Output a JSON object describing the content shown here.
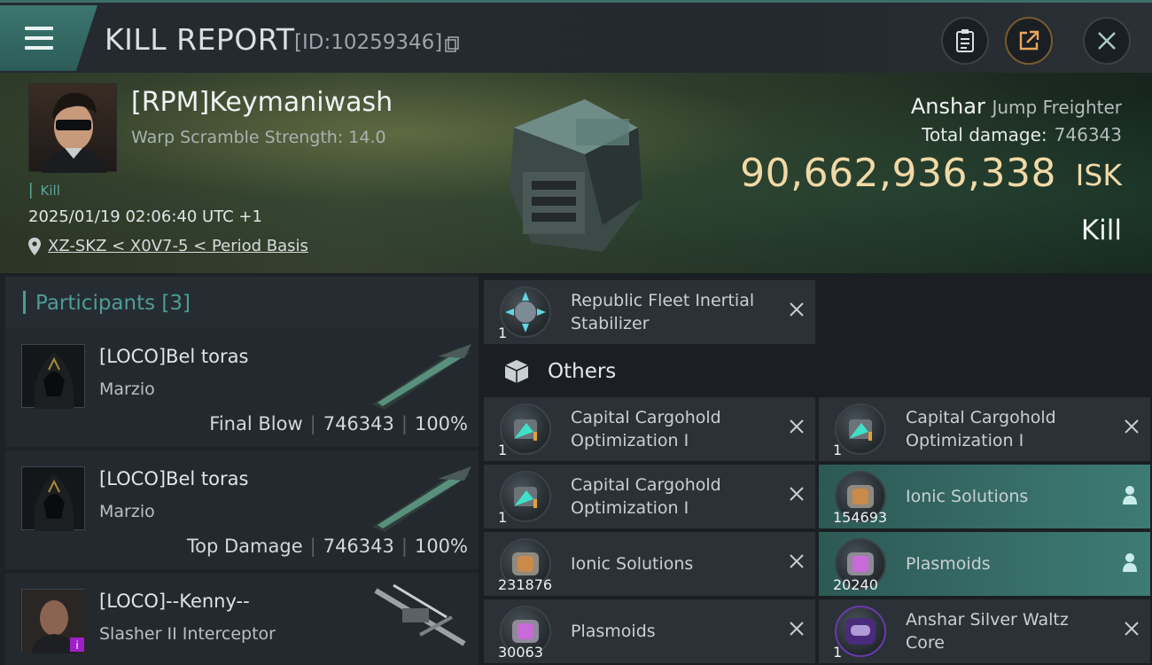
{
  "header": {
    "title": "KILL REPORT",
    "report_id": "[ID:10259346]"
  },
  "victim": {
    "name": "[RPM]Keymaniwash",
    "warp_scramble": "Warp Scramble Strength: 14.0",
    "kill_tag": "Kill",
    "datetime": "2025/01/19 02:06:40 UTC +1",
    "location": "XZ-SKZ < X0V7-5 < Period Basis"
  },
  "ship": {
    "name": "Anshar",
    "class": "Jump Freighter",
    "total_damage_label": "Total damage:",
    "total_damage_value": "746343",
    "isk_value": "90,662,936,338",
    "isk_unit": "ISK",
    "kill_type": "Kill"
  },
  "participants": {
    "header": "Participants [3]",
    "rows": [
      {
        "name": "[LOCO]Bel toras",
        "ship": "Marzio",
        "role": "Final Blow",
        "damage": "746343",
        "percent": "100%"
      },
      {
        "name": "[LOCO]Bel toras",
        "ship": "Marzio",
        "role": "Top Damage",
        "damage": "746343",
        "percent": "100%"
      },
      {
        "name": "[LOCO]--Kenny--",
        "ship": "Slasher II Interceptor"
      }
    ]
  },
  "items": {
    "top_item": {
      "name": "Republic Fleet Inertial Stabilizer",
      "qty": "1"
    },
    "others_label": "Others",
    "others": [
      {
        "name": "Capital Cargohold Optimization I",
        "qty": "1",
        "status": "destroyed"
      },
      {
        "name": "Capital Cargohold Optimization I",
        "qty": "1",
        "status": "destroyed"
      },
      {
        "name": "Capital Cargohold Optimization I",
        "qty": "1",
        "status": "destroyed"
      },
      {
        "name": "Ionic Solutions",
        "qty": "154693",
        "status": "dropped"
      },
      {
        "name": "Ionic Solutions",
        "qty": "231876",
        "status": "destroyed"
      },
      {
        "name": "Plasmoids",
        "qty": "20240",
        "status": "dropped"
      },
      {
        "name": "Plasmoids",
        "qty": "30063",
        "status": "destroyed"
      },
      {
        "name": "Anshar Silver Waltz Core",
        "qty": "1",
        "status": "destroyed"
      }
    ]
  },
  "colors": {
    "accent_teal": "#4f9c95",
    "isk_gold": "#f1d9a6",
    "dropped_highlight": "#3e7b75"
  }
}
